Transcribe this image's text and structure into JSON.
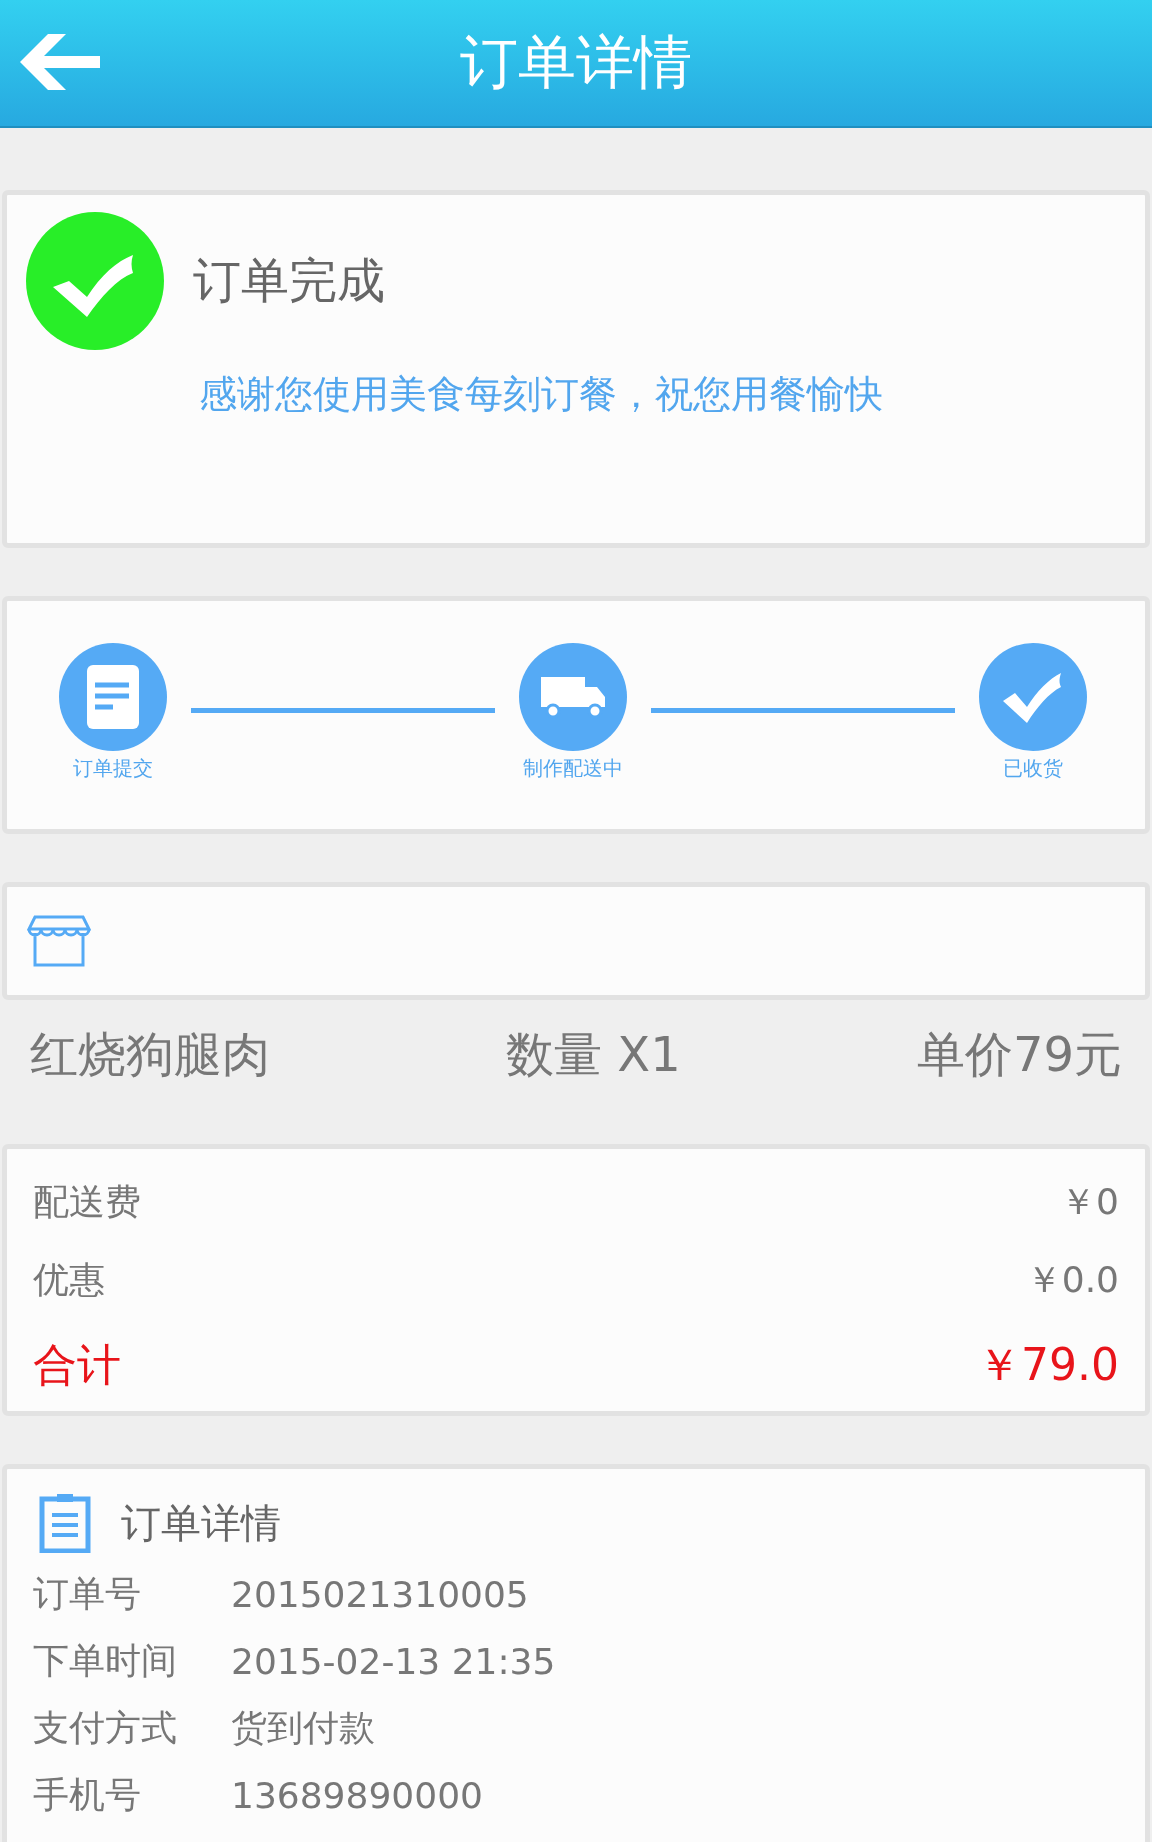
{
  "header": {
    "title": "订单详情"
  },
  "status": {
    "title": "订单完成",
    "message": "感谢您使用美食每刻订餐，祝您用餐愉快"
  },
  "progress": [
    {
      "kind": "document",
      "label": "订单提交"
    },
    {
      "kind": "truck",
      "label": "制作配送中"
    },
    {
      "kind": "check",
      "label": "已收货"
    }
  ],
  "item": {
    "name": "红烧狗腿肉",
    "quantity": "数量 X1",
    "price": "单价79元"
  },
  "fees": [
    {
      "kind": "normal",
      "label": "配送费",
      "value": "￥0"
    },
    {
      "kind": "normal",
      "label": "优惠",
      "value": "￥0.0"
    },
    {
      "kind": "total",
      "label": "合计",
      "value": "￥79.0"
    }
  ],
  "details": {
    "title": "订单详情",
    "rows": [
      {
        "label": "订单号",
        "value": "2015021310005"
      },
      {
        "label": "下单时间",
        "value": "2015-02-13 21:35"
      },
      {
        "label": "支付方式",
        "value": "货到付款"
      },
      {
        "label": "手机号",
        "value": "13689890000"
      }
    ]
  }
}
